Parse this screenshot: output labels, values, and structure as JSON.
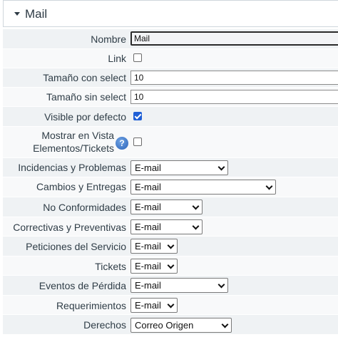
{
  "header": {
    "title": "Mail"
  },
  "fields": {
    "nombre": {
      "label": "Nombre",
      "value": "Mail"
    },
    "link": {
      "label": "Link",
      "checked": false
    },
    "tamano_con_select": {
      "label": "Tamaño con select",
      "value": "10"
    },
    "tamano_sin_select": {
      "label": "Tamaño sin select",
      "value": "10"
    },
    "visible_por_defecto": {
      "label": "Visible por defecto",
      "checked": true
    },
    "mostrar_vista": {
      "label_line1": "Mostrar en Vista",
      "label_line2": "Elementos/Tickets",
      "help": "?",
      "checked": false
    },
    "incidencias": {
      "label": "Incidencias y Problemas",
      "value": "E-mail"
    },
    "cambios": {
      "label": "Cambios y Entregas",
      "value": "E-mail"
    },
    "no_conformidades": {
      "label": "No Conformidades",
      "value": "E-mail"
    },
    "correctivas": {
      "label": "Correctivas y Preventivas",
      "value": "E-mail"
    },
    "peticiones": {
      "label": "Peticiones del Servicio",
      "value": "E-mail"
    },
    "tickets": {
      "label": "Tickets",
      "value": "E-mail"
    },
    "eventos": {
      "label": "Eventos de Pérdida",
      "value": "E-mail"
    },
    "requerimientos": {
      "label": "Requerimientos",
      "value": "E-mail"
    },
    "derechos": {
      "label": "Derechos",
      "value": "Correo Origen"
    }
  },
  "icons": {
    "caret": "caret-down-icon",
    "help": "help-icon",
    "chevron": "chevron-down-icon"
  },
  "colors": {
    "row_odd": "#eff2f4",
    "row_even": "#f8f9fa",
    "checkbox_checked": "#1f5fd6",
    "help_icon": "#2c63b8"
  }
}
